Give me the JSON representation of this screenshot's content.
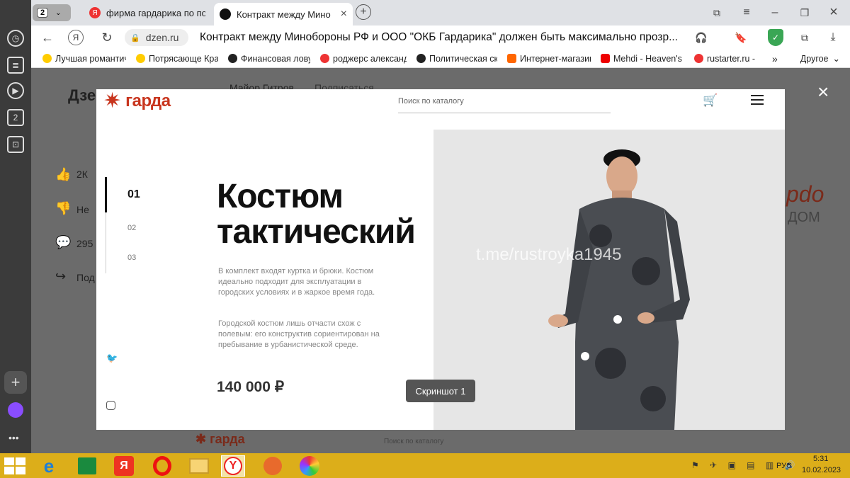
{
  "browser": {
    "tab_count": "2",
    "tabs": [
      {
        "title": "фирма гардарика по пош"
      },
      {
        "title": "Контракт между Мино"
      }
    ],
    "address_url": "dzen.ru",
    "page_title": "Контракт между Минобороны РФ и ООО \"ОКБ Гардарика\" должен быть максимально прозр...",
    "yandex_btn": "Я",
    "bookmarks": [
      {
        "label": "Лучшая романтич"
      },
      {
        "label": "Потрясающе Крас"
      },
      {
        "label": "Финансовая ловуш"
      },
      {
        "label": "роджерс александ"
      },
      {
        "label": "Политическая ска"
      },
      {
        "label": "Интернет-магазин"
      },
      {
        "label": "Mehdi - Heaven's"
      },
      {
        "label": "rustarter.ru -"
      }
    ],
    "bookmarks_more": "»",
    "bookmarks_other": "Другое",
    "side_badge": "2"
  },
  "background_page": {
    "logo": "Дзен",
    "author": "Майор Гитров",
    "subscribe": "Подписаться",
    "likes": "2К",
    "dislike": "Не",
    "comments": "295",
    "share": "Под",
    "ad_text": "рdo",
    "ad_text2": "ДОМ",
    "bottom_logo": "гарда",
    "bottom_search": "Поиск по каталогу"
  },
  "modal": {
    "brand": "гарда",
    "search_placeholder": "Поиск по каталогу",
    "slides": [
      "01",
      "02",
      "03"
    ],
    "heading_line1": "Костюм",
    "heading_line2": "тактический",
    "desc1": "В комплект входят куртка и брюки. Костюм идеально подходит для эксплуатации в городских условиях и в жаркое время года.",
    "desc2": "Городской костюм лишь отчасти схож с полевым: его конструктив сориентирован на пребывание в урбанистической среде.",
    "price": "140 000 ₽",
    "watermark": "t.me/rustroyka1945",
    "screenshot_label": "Скриншот 1"
  },
  "taskbar": {
    "lang": "РУС",
    "time": "5:31",
    "date": "10.02.2023"
  },
  "colors": {
    "brand_red": "#c8351e",
    "sidebar": "#3b3b3b",
    "tabbar": "#dfe1e5",
    "taskbar": "#dcae1a"
  }
}
